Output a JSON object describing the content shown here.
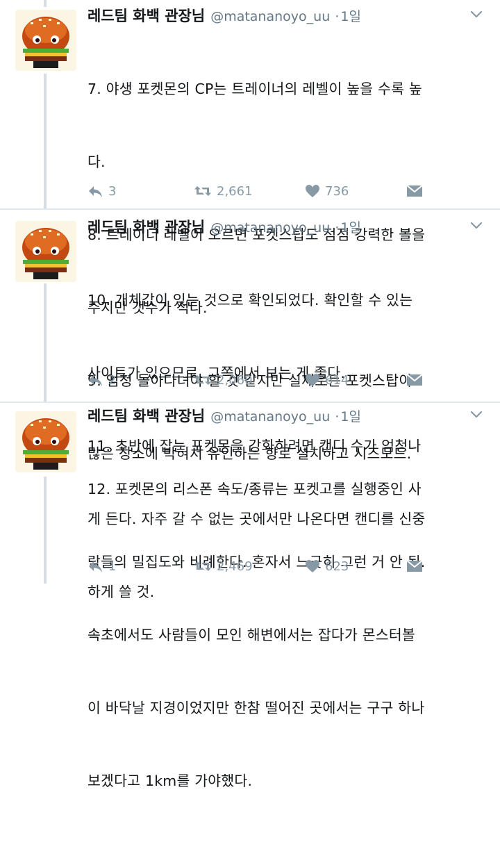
{
  "tweets": [
    {
      "author": "레드팀 화백 관장님",
      "handle": "@matananoyo_uu",
      "dot": "·",
      "time": "1일",
      "lines": [
        "7. 야생 포켓몬의 CP는 트레이너의 레벨이 높을 수록 높",
        "다.",
        "8. 트레이너 레벨이 오르면 포켓스탑도 점점 강력한 볼을",
        "주지만 갯수가 적다.",
        "9. 엄청 돌아다녀야 할 것 같지만 실제로는 포켓스탑이",
        "많은 장소에 박혀서 유인하는 향로 설치하고 시즈모드."
      ],
      "replies": "3",
      "retweets": "2,661",
      "likes": "736"
    },
    {
      "author": "레드팀 화백 관장님",
      "handle": "@matananoyo_uu",
      "dot": "·",
      "time": "1일",
      "lines": [
        "10. 개체값이 있는 것으로 확인되었다. 확인할 수 있는",
        "사이트가 있으므로, 그쪽에서 보는 게 좋다.",
        "11. 초반에 잡는 포켓몬을 강화하려면 캔디 수가 엄청나",
        "게 든다. 자주 갈 수 없는 곳에서만 나온다면 캔디를 신중",
        "하게 쓸 것."
      ],
      "replies": "2",
      "retweets": "2,060",
      "likes": "614"
    },
    {
      "author": "레드팀 화백 관장님",
      "handle": "@matananoyo_uu",
      "dot": "·",
      "time": "1일",
      "lines": [
        "12. 포켓몬의 리스폰 속도/종류는 포켓고를 실행중인 사",
        "람들의 밀집도와 비례한다. 혼자서 느긋히 그런 거 안 됨.",
        "속초에서도 사람들이 모인 해변에서는 잡다가 몬스터볼",
        "이 바닥날 지경이었지만 한참 떨어진 곳에서는 구구 하나",
        "보겠다고 1km를 가야했다."
      ],
      "replies": "1",
      "retweets": "2,469",
      "likes": "623"
    }
  ],
  "colors": {
    "muted": "#8899a6",
    "handle": "#657786",
    "divider": "#e1e8ed",
    "thread": "#d6dee4"
  }
}
